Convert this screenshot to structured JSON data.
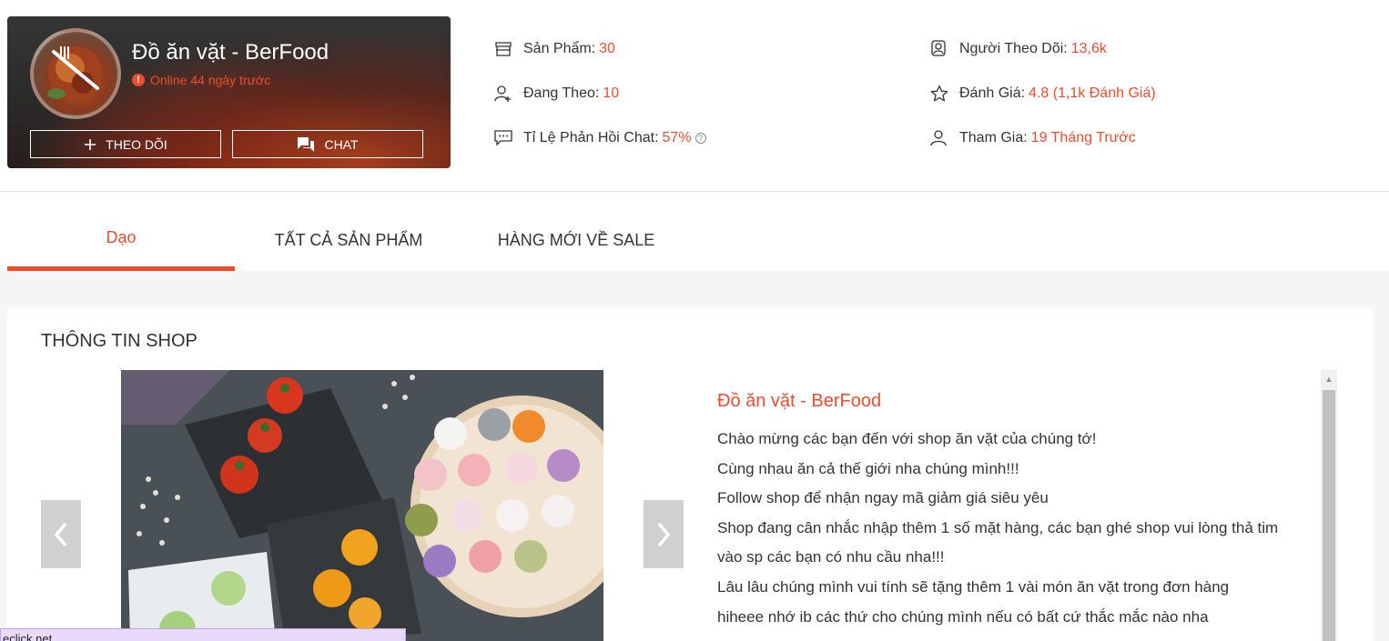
{
  "shop": {
    "name": "Đồ ăn vặt - BerFood",
    "online_status": "Online 44 ngày trước",
    "follow_button": "THEO DÕI",
    "chat_button": "CHAT"
  },
  "stats": {
    "products_label": "Sản Phẩm:",
    "products_value": "30",
    "following_label": "Đang Theo:",
    "following_value": "10",
    "chat_response_label": "Tỉ Lệ Phản Hồi Chat:",
    "chat_response_value": "57%",
    "followers_label": "Người Theo Dõi:",
    "followers_value": "13,6k",
    "rating_label": "Đánh Giá:",
    "rating_value": "4.8 (1,1k Đánh Giá)",
    "joined_label": "Tham Gia:",
    "joined_value": "19 Tháng Trước"
  },
  "tabs": [
    {
      "label": "Dạo",
      "active": true
    },
    {
      "label": "TẤT CẢ SẢN PHẨM",
      "active": false
    },
    {
      "label": "HÀNG MỚI VỀ SALE",
      "active": false
    }
  ],
  "shop_info": {
    "section_title": "THÔNG TIN SHOP",
    "title": "Đồ ăn vặt - BerFood",
    "lines": [
      "Chào mừng các bạn đến với shop ăn vặt của chúng tớ!",
      "Cùng nhau ăn cả thế giới nha chúng mình!!!",
      "Follow shop để nhận ngay mã giảm giá siêu yêu",
      "Shop đang cân nhắc nhập thêm 1 số mặt hàng, các bạn ghé shop vui lòng thả tim",
      "vào sp các bạn có nhu cầu nha!!!",
      "Lâu lâu chúng mình vui tính sẽ tặng thêm 1 vài món ăn vặt trong đơn hàng",
      "hiheee nhớ ib các thứ cho chúng mình nếu có bất cứ thắc mắc nào nha"
    ]
  },
  "status_tip": "eclick.net",
  "colors": {
    "accent": "#ee4d2d",
    "panel_bg": "#f5f5f5"
  },
  "icons": [
    "store-icon",
    "user-plus-icon",
    "chat-bubble-icon",
    "followers-icon",
    "star-icon",
    "user-icon",
    "plus-icon",
    "chat-icon",
    "chevron-left-icon",
    "chevron-right-icon",
    "help-icon"
  ]
}
